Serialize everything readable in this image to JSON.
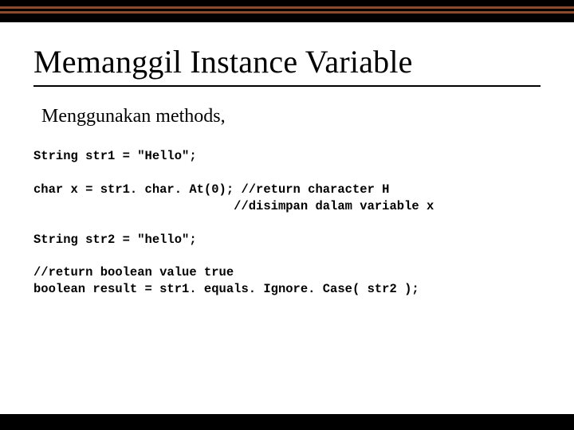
{
  "slide": {
    "title": "Memanggil Instance Variable",
    "subtitle": "Menggunakan methods,",
    "code": {
      "line1": "String str1 = \"Hello\";",
      "line2": "char x = str1. char. At(0); //return character H",
      "line3": "                           //disimpan dalam variable x",
      "line4": "String str2 = \"hello\";",
      "line5": "//return boolean value true",
      "line6": "boolean result = str1. equals. Ignore. Case( str2 );"
    }
  }
}
